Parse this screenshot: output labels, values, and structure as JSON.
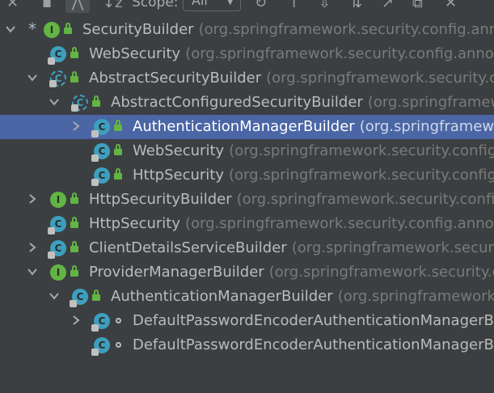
{
  "toolbar": {
    "scope_label": "Scope:",
    "scope_value": "All",
    "icons": [
      "collapse-icon",
      "pin-icon",
      "hierarchy-icon",
      "sort-alpha-icon",
      "refresh-icon",
      "up-icon",
      "export-icon",
      "autoscroll-icon",
      "jump-icon",
      "open-window-icon",
      "close-icon"
    ]
  },
  "rows": [
    {
      "name": "SecurityBuilder",
      "pkg": "(org.springframework.security.config.annot",
      "kind": "interface",
      "expanded": true,
      "marker": "*"
    },
    {
      "name": "WebSecurity",
      "pkg": "(org.springframework.security.config.annotat",
      "kind": "class"
    },
    {
      "name": "AbstractSecurityBuilder",
      "pkg": "(org.springframework.security.cor",
      "kind": "abstract",
      "expanded": true
    },
    {
      "name": "AbstractConfiguredSecurityBuilder",
      "pkg": "(org.springframewo",
      "kind": "abstract",
      "expanded": true
    },
    {
      "name": "AuthenticationManagerBuilder",
      "pkg": "(org.springframewo",
      "kind": "class",
      "expanded": false,
      "selected": true
    },
    {
      "name": "WebSecurity",
      "pkg": "(org.springframework.security.config.a",
      "kind": "class"
    },
    {
      "name": "HttpSecurity",
      "pkg": "(org.springframework.security.config.a",
      "kind": "class"
    },
    {
      "name": "HttpSecurityBuilder",
      "pkg": "(org.springframework.security.config.a",
      "kind": "interface",
      "expanded": false
    },
    {
      "name": "HttpSecurity",
      "pkg": "(org.springframework.security.config.annotat",
      "kind": "class"
    },
    {
      "name": "ClientDetailsServiceBuilder",
      "pkg": "(org.springframework.security.",
      "kind": "class",
      "expanded": false
    },
    {
      "name": "ProviderManagerBuilder",
      "pkg": "(org.springframework.security.co",
      "kind": "interface",
      "expanded": true
    },
    {
      "name": "AuthenticationManagerBuilder",
      "pkg": "(org.springframework.s",
      "kind": "class",
      "expanded": true
    },
    {
      "name": "DefaultPasswordEncoderAuthenticationManagerBui",
      "pkg": "",
      "kind": "class",
      "expanded": false
    },
    {
      "name": "DefaultPasswordEncoderAuthenticationManagerBui",
      "pkg": "",
      "kind": "class"
    }
  ]
}
